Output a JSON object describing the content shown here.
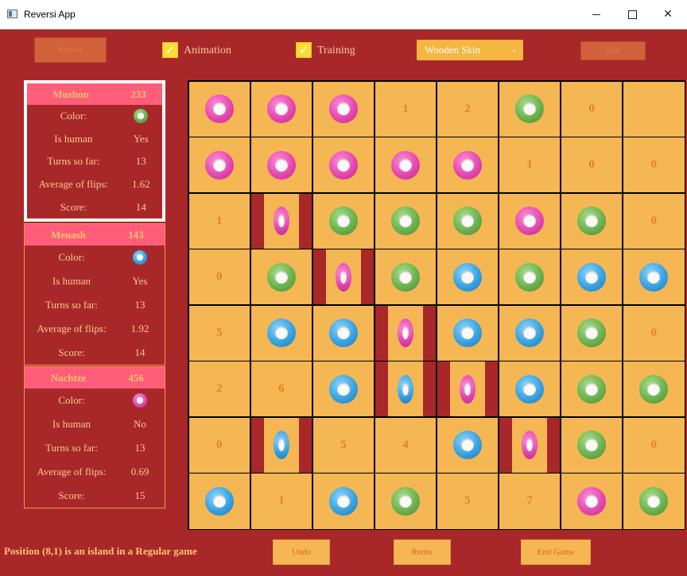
{
  "window": {
    "title": "Reversi App"
  },
  "toolbar": {
    "browse_label": "Browse",
    "animation_label": "Animation",
    "animation_checked": true,
    "training_label": "Training",
    "training_checked": true,
    "skin_selected": "Wooden Skin",
    "start_label": "Start"
  },
  "players": [
    {
      "name": "Mushon",
      "score_total": "233",
      "color_label": "Color:",
      "color": "green",
      "human_label": "Is human",
      "human": "Yes",
      "turns_label": "Turns so far:",
      "turns": "13",
      "avg_label": "Average of flips:",
      "avg": "1.62",
      "score_label": "Score:",
      "score": "14",
      "active": true
    },
    {
      "name": "Menash",
      "score_total": "143",
      "color_label": "Color:",
      "color": "blue",
      "human_label": "Is human",
      "human": "Yes",
      "turns_label": "Turns so far:",
      "turns": "13",
      "avg_label": "Average of flips:",
      "avg": "1.92",
      "score_label": "Score:",
      "score": "14",
      "active": false
    },
    {
      "name": "Nachtze",
      "score_total": "456",
      "color_label": "Color:",
      "color": "pink",
      "human_label": "Is human",
      "human": "No",
      "turns_label": "Turns so far:",
      "turns": "13",
      "avg_label": "Average of flips:",
      "avg": "0.69",
      "score_label": "Score:",
      "score": "15",
      "active": false
    }
  ],
  "board": [
    [
      "P",
      "P",
      "P",
      "1",
      "2",
      "G",
      "0",
      ""
    ],
    [
      "P",
      "P",
      "P",
      "P",
      "P",
      "1",
      "0",
      "0"
    ],
    [
      "1",
      "P*",
      "G",
      "G",
      "G",
      "P",
      "G",
      "0"
    ],
    [
      "0",
      "G",
      "P*",
      "G",
      "B",
      "G",
      "B",
      "B"
    ],
    [
      "5",
      "B",
      "B",
      "P*",
      "B",
      "B",
      "G",
      "0"
    ],
    [
      "2",
      "6",
      "B",
      "B*",
      "P*",
      "B",
      "G",
      "G"
    ],
    [
      "0",
      "B*",
      "5",
      "4",
      "B",
      "P*",
      "G",
      "0"
    ],
    [
      "B",
      "1",
      "B",
      "G",
      "5",
      "7",
      "P",
      "G"
    ]
  ],
  "colors": {
    "pink": "#e548b0",
    "green": "#6bb24e",
    "blue": "#37a2e0",
    "background": "#a8282a",
    "cell": "#f5b654"
  },
  "status": "Position (8,1) is an island in a Regular game",
  "buttons": {
    "undo": "Undo",
    "retire": "Retire",
    "end_game": "End Game"
  }
}
